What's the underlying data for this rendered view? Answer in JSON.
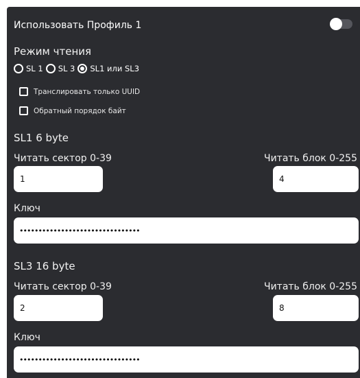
{
  "profile": {
    "title": "Использовать Профиль 1",
    "enabled": false
  },
  "read_mode": {
    "label": "Режим чтения",
    "options": [
      "SL 1",
      "SL 3",
      "SL1 или SL3"
    ],
    "selected": "SL1 или SL3"
  },
  "checkboxes": [
    {
      "label": "Транслировать только UUID",
      "checked": false
    },
    {
      "label": "Обратный порядок байт",
      "checked": false
    }
  ],
  "sl1": {
    "header": "SL1 6 byte",
    "sector_label": "Читать сектор 0-39",
    "sector_value": "1",
    "block_label": "Читать блок 0-255",
    "block_value": "4",
    "key_label": "Ключ",
    "key_value": "••••••••••••••••••••••••••••••••"
  },
  "sl3": {
    "header": "SL3 16 byte",
    "sector_label": "Читать сектор 0-39",
    "sector_value": "2",
    "block_label": "Читать блок 0-255",
    "block_value": "8",
    "key_label": "Ключ",
    "key_value": "••••••••••••••••••••••••••••••••"
  },
  "colors": {
    "panel_bg": "#2b2c30",
    "text": "#ffffff",
    "input_bg": "#ffffff"
  }
}
